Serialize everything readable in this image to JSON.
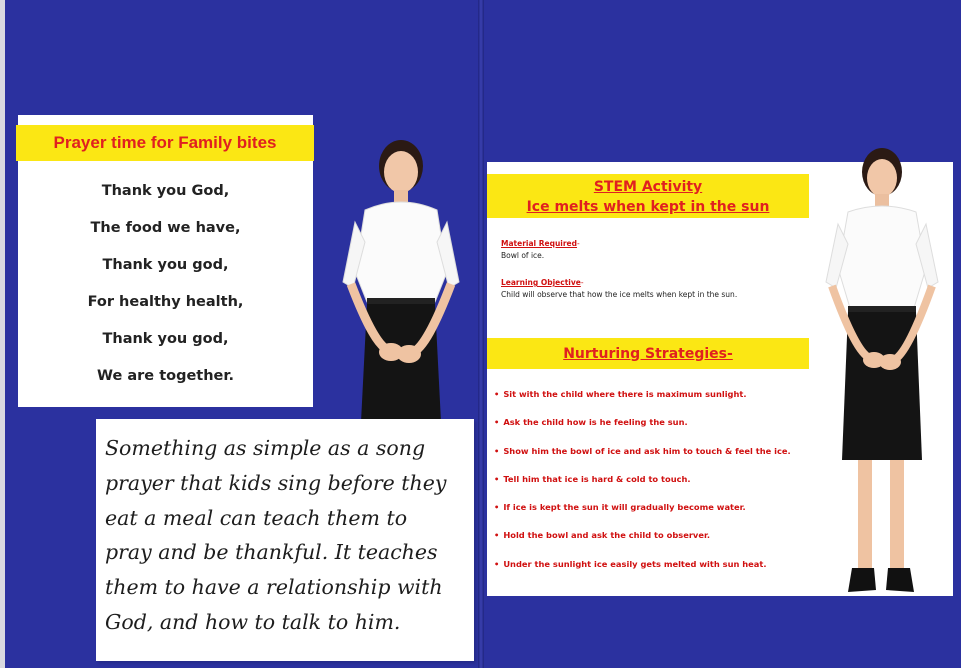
{
  "left_page": {
    "prayer_title": "Prayer time for Family bites",
    "prayer_lines": [
      "Thank you God,",
      "The food we have,",
      "Thank you god,",
      "For healthy health,",
      "Thank you god,",
      "We are together."
    ],
    "note_lines": [
      "Something as simple as a song",
      "prayer that kids sing before they",
      "eat a meal can teach them to",
      "pray and be thankful. It teaches",
      "them to have a relationship with",
      "God, and how to talk to him."
    ]
  },
  "right_page": {
    "stem_title_line1": "STEM Activity",
    "stem_title_line2": "Ice melts when kept in the sun",
    "material_label": "Material Required",
    "material_text": "Bowl of ice.",
    "objective_label": "Learning Objective",
    "objective_text": "Child will observe that how the ice melts when kept in the sun.",
    "nurturing_title": "Nurturing Strategies-",
    "strategies": [
      "Sit with the child where there is maximum sunlight.",
      "Ask the child how is he feeling the sun.",
      "Show him the bowl of ice and ask him to touch & feel the ice.",
      "Tell him that ice is hard & cold to touch.",
      "If ice is kept the sun it will gradually become water.",
      "Hold the bowl and ask the child to observer.",
      "Under the sunlight ice easily gets melted with sun heat."
    ]
  },
  "colors": {
    "background": "#2b319f",
    "highlight": "#fbe714",
    "title_red": "#e02020"
  }
}
